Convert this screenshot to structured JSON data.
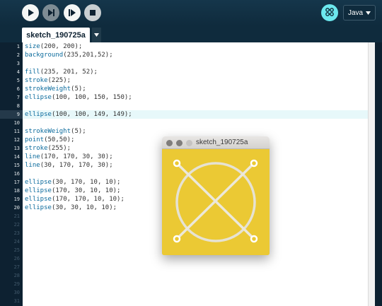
{
  "toolbar": {
    "buttons": [
      {
        "name": "run",
        "icon": "play-icon"
      },
      {
        "name": "step",
        "icon": "step-icon"
      },
      {
        "name": "tweak",
        "icon": "tweak-icon"
      },
      {
        "name": "stop",
        "icon": "stop-icon"
      }
    ],
    "debug_icon": "debugger-icon",
    "mode_label": "Java",
    "mode_icon": "chevron-down-icon"
  },
  "tabs": [
    {
      "label": "sketch_190725a",
      "active": true
    }
  ],
  "tab_menu_icon": "chevron-down-icon",
  "editor": {
    "highlighted_line": 9,
    "line_numbers": [
      "1",
      "2",
      "3",
      "4",
      "5",
      "6",
      "7",
      "8",
      "9",
      "10",
      "11",
      "12",
      "13",
      "14",
      "15",
      "16",
      "17",
      "18",
      "19",
      "20",
      "21",
      "22",
      "23",
      "24",
      "25",
      "26",
      "27",
      "28",
      "29",
      "30",
      "31"
    ],
    "lines": [
      "size(200, 200);",
      "background(235,201,52);",
      "",
      "fill(235, 201, 52);",
      "stroke(225);",
      "strokeWeight(5);",
      "ellipse(100, 100, 150, 150);",
      "",
      "ellipse(100, 100, 149, 149);",
      "",
      "strokeWeight(5);",
      "point(50,50);",
      "stroke(255);",
      "line(170, 170, 30, 30);",
      "line(30, 170, 170, 30);",
      "",
      "ellipse(30, 170, 10, 10);",
      "ellipse(170, 30, 10, 10);",
      "ellipse(170, 170, 10, 10);",
      "ellipse(30, 30, 10, 10);"
    ]
  },
  "sketch_window": {
    "title": "sketch_190725a",
    "background": "#ebc934",
    "stroke_color": "#e6e2d3"
  },
  "colors": {
    "toolbar_bg": "#0f2b3d",
    "gutter_bg": "#0d2131",
    "debug_accent": "#6ce8ee",
    "highlight_row": "#e7f8fa"
  }
}
